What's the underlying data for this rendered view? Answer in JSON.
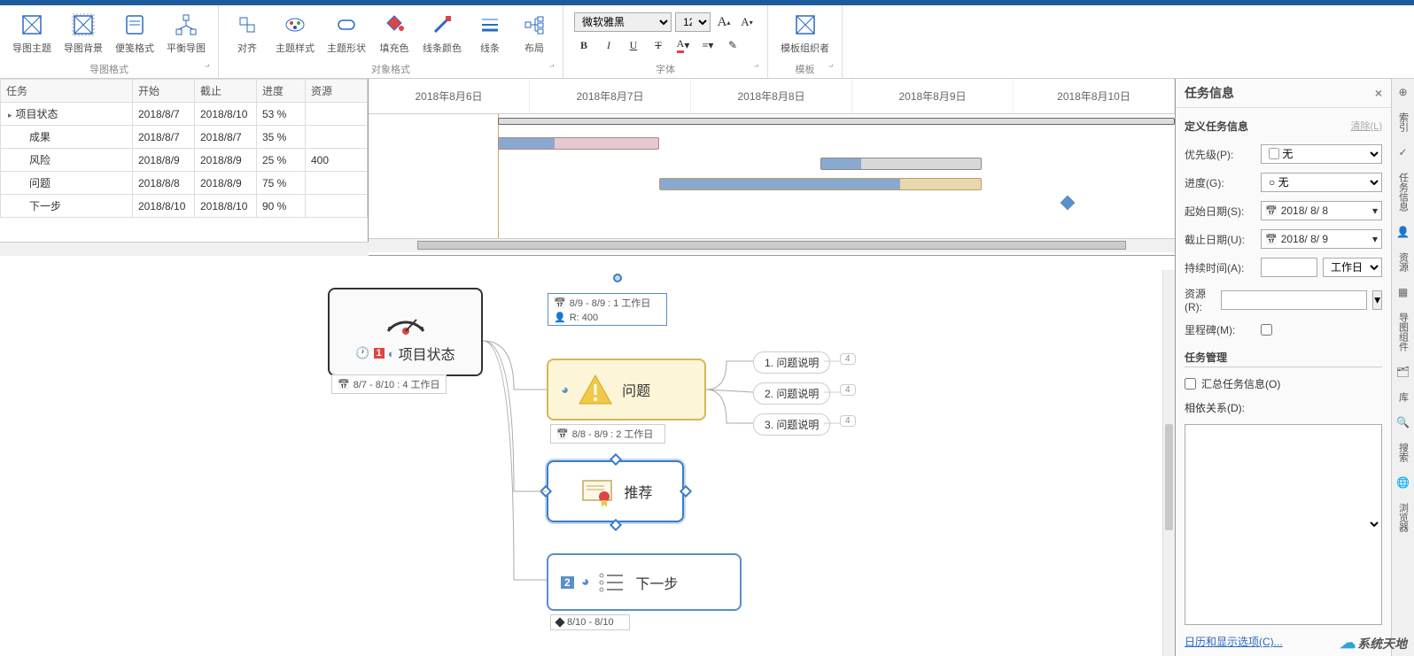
{
  "ribbon": {
    "group1": {
      "label": "导图格式",
      "btns": [
        {
          "label": "导图主题"
        },
        {
          "label": "导图背景"
        },
        {
          "label": "便笺格式"
        },
        {
          "label": "平衡导图"
        }
      ]
    },
    "group2": {
      "label": "对象格式",
      "btns": [
        {
          "label": "对齐"
        },
        {
          "label": "主题样式"
        },
        {
          "label": "主题形状"
        },
        {
          "label": "填充色"
        },
        {
          "label": "线条颜色"
        },
        {
          "label": "线条"
        },
        {
          "label": "布局"
        }
      ]
    },
    "group3": {
      "label": "字体",
      "font_name": "微软雅黑",
      "font_size": "12"
    },
    "group4": {
      "label": "模板",
      "btns": [
        {
          "label": "模板组织者"
        }
      ]
    }
  },
  "task_table": {
    "cols": [
      "任务",
      "开始",
      "截止",
      "进度",
      "资源"
    ],
    "rows": [
      {
        "name": "项目状态",
        "start": "2018/8/7",
        "end": "2018/8/10",
        "progress": "53 %",
        "res": "",
        "cls": "parent"
      },
      {
        "name": "成果",
        "start": "2018/8/7",
        "end": "2018/8/7",
        "progress": "35 %",
        "res": "",
        "cls": "child"
      },
      {
        "name": "风险",
        "start": "2018/8/9",
        "end": "2018/8/9",
        "progress": "25 %",
        "res": "400",
        "cls": "child"
      },
      {
        "name": "问题",
        "start": "2018/8/8",
        "end": "2018/8/9",
        "progress": "75 %",
        "res": "",
        "cls": "child"
      },
      {
        "name": "下一步",
        "start": "2018/8/10",
        "end": "2018/8/10",
        "progress": "90 %",
        "res": "",
        "cls": "child"
      }
    ]
  },
  "gantt": {
    "dates": [
      "2018年8月6日",
      "2018年8月7日",
      "2018年8月8日",
      "2018年8月9日",
      "2018年8月10日"
    ]
  },
  "canvas": {
    "main_node": "项目状态",
    "main_caption": "8/7 - 8/10 : 4 工作日",
    "risk_caption": "8/9 - 8/9 : 1 工作日",
    "risk_res": "R: 400",
    "problem": "问题",
    "problem_caption": "8/8 - 8/9 : 2 工作日",
    "problem_items": [
      "1. 问题说明",
      "2. 问题说明",
      "3. 问题说明"
    ],
    "problem_badge": "4",
    "recommend": "推荐",
    "next": "下一步",
    "next_caption": "8/10 - 8/10"
  },
  "panel": {
    "title": "任务信息",
    "clear": "清除(L)",
    "section1": "定义任务信息",
    "priority_label": "优先级(P):",
    "priority_val": "无",
    "progress_label": "进度(G):",
    "progress_val": "无",
    "start_label": "起始日期(S):",
    "start_val": "2018/ 8/ 8",
    "end_label": "截止日期(U):",
    "end_val": "2018/ 8/ 9",
    "duration_label": "持续时间(A):",
    "duration_unit": "工作日",
    "resource_label": "资源(R):",
    "milestone_label": "里程碑(M):",
    "section2": "任务管理",
    "summary_label": "汇总任务信息(O)",
    "depend_label": "相依关系(D):",
    "link": "日历和显示选项(C)..."
  },
  "sidebar": {
    "items": [
      "索引",
      "任务信息",
      "资源",
      "导图组件",
      "库",
      "搜索",
      "浏览器"
    ]
  },
  "watermark": "系统天地"
}
